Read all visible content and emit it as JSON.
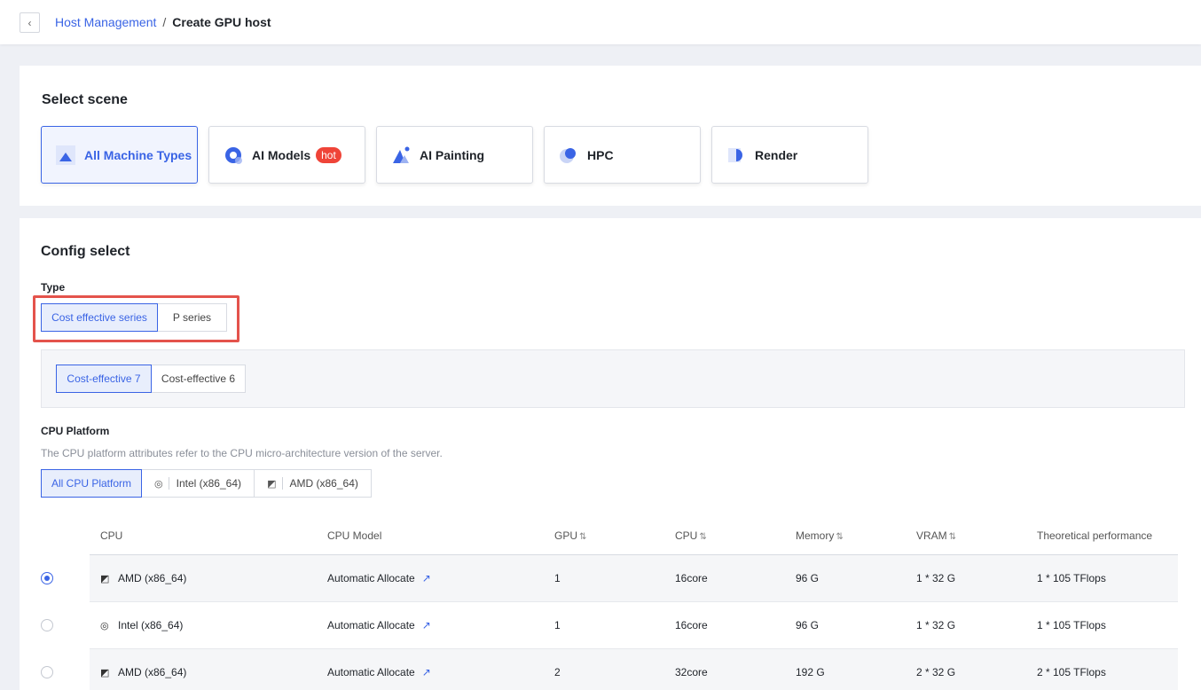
{
  "breadcrumb": {
    "parent": "Host Management",
    "separator": "/",
    "current": "Create GPU host"
  },
  "scene": {
    "title": "Select scene",
    "tiles": [
      {
        "label": "All Machine Types",
        "icon": "mountain-icon",
        "active": true
      },
      {
        "label": "AI Models",
        "icon": "ai-models-icon",
        "badge": "hot"
      },
      {
        "label": "AI Painting",
        "icon": "ai-painting-icon"
      },
      {
        "label": "HPC",
        "icon": "hpc-icon"
      },
      {
        "label": "Render",
        "icon": "render-icon"
      }
    ]
  },
  "config": {
    "title": "Config select",
    "type_label": "Type",
    "types": [
      "Cost effective series",
      "P series"
    ],
    "sub_types": [
      "Cost-effective 7",
      "Cost-effective 6"
    ],
    "cpu_platform_label": "CPU Platform",
    "cpu_platform_desc": "The CPU platform attributes refer to the CPU micro-architecture version of the server.",
    "cpu_platforms": [
      {
        "label": "All CPU Platform",
        "icon": null
      },
      {
        "label": "Intel (x86_64)",
        "icon": "intel-icon"
      },
      {
        "label": "AMD (x86_64)",
        "icon": "amd-icon"
      }
    ]
  },
  "table": {
    "headers": [
      "CPU",
      "CPU Model",
      "GPU",
      "CPU",
      "Memory",
      "VRAM",
      "Theoretical performance"
    ],
    "rows": [
      {
        "cpu": "AMD (x86_64)",
        "cpu_icon": "amd-icon",
        "model": "Automatic Allocate",
        "gpu": "1",
        "cpu_cores": "16core",
        "memory": "96 G",
        "vram": "1 * 32 G",
        "perf": "1 * 105 TFlops",
        "selected": true
      },
      {
        "cpu": "Intel (x86_64)",
        "cpu_icon": "intel-icon",
        "model": "Automatic Allocate",
        "gpu": "1",
        "cpu_cores": "16core",
        "memory": "96 G",
        "vram": "1 * 32 G",
        "perf": "1 * 105 TFlops",
        "selected": false
      },
      {
        "cpu": "AMD (x86_64)",
        "cpu_icon": "amd-icon",
        "model": "Automatic Allocate",
        "gpu": "2",
        "cpu_cores": "32core",
        "memory": "192 G",
        "vram": "2 * 32 G",
        "perf": "2 * 105 TFlops",
        "selected": false
      }
    ]
  },
  "colors": {
    "accent": "#3a64e5",
    "highlight": "#e4534c",
    "hot": "#ef4438"
  }
}
